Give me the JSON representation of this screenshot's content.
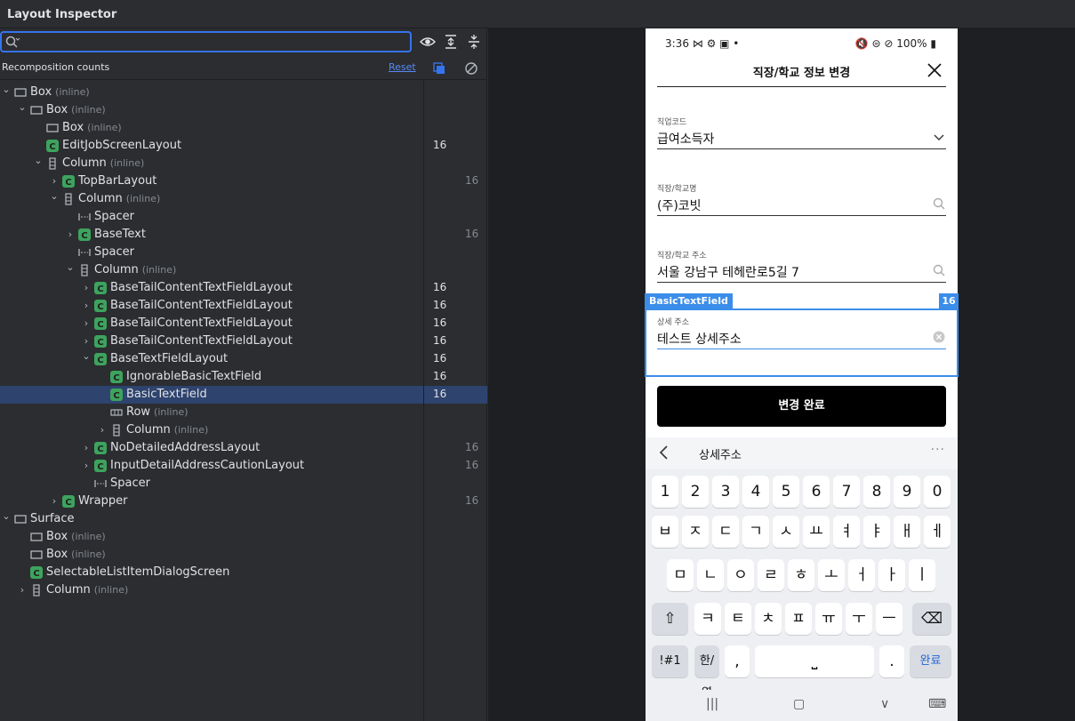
{
  "window": {
    "title": "Layout Inspector"
  },
  "toolbar": {
    "search_value": "",
    "search_placeholder": ""
  },
  "header": {
    "label": "Recomposition counts",
    "reset_label": "Reset"
  },
  "tree": [
    {
      "label": "Box",
      "tag": "(inline)",
      "count": "",
      "icon": "box-icon",
      "chev": "down"
    },
    {
      "label": "Box",
      "tag": "(inline)",
      "count": "",
      "icon": "box-icon",
      "chev": "down"
    },
    {
      "label": "Box",
      "tag": "(inline)",
      "count": "",
      "icon": "box-icon",
      "chev": ""
    },
    {
      "label": "EditJobScreenLayout",
      "tag": "",
      "count": "16",
      "icon": "compose-icon",
      "chev": ""
    },
    {
      "label": "Column",
      "tag": "(inline)",
      "count": "",
      "icon": "column-icon",
      "chev": "down"
    },
    {
      "label": "TopBarLayout",
      "tag": "",
      "count": "16",
      "icon": "compose-icon",
      "chev": "right"
    },
    {
      "label": "Column",
      "tag": "(inline)",
      "count": "",
      "icon": "column-icon",
      "chev": "down"
    },
    {
      "label": "Spacer",
      "tag": "",
      "count": "",
      "icon": "spacer-icon",
      "chev": ""
    },
    {
      "label": "BaseText",
      "tag": "",
      "count": "16",
      "icon": "compose-icon",
      "chev": "right"
    },
    {
      "label": "Spacer",
      "tag": "",
      "count": "",
      "icon": "spacer-icon",
      "chev": ""
    },
    {
      "label": "Column",
      "tag": "(inline)",
      "count": "",
      "icon": "column-icon",
      "chev": "down"
    },
    {
      "label": "BaseTailContentTextFieldLayout",
      "tag": "",
      "count": "16",
      "icon": "compose-icon",
      "chev": "right"
    },
    {
      "label": "BaseTailContentTextFieldLayout",
      "tag": "",
      "count": "16",
      "icon": "compose-icon",
      "chev": "right"
    },
    {
      "label": "BaseTailContentTextFieldLayout",
      "tag": "",
      "count": "16",
      "icon": "compose-icon",
      "chev": "right"
    },
    {
      "label": "BaseTailContentTextFieldLayout",
      "tag": "",
      "count": "16",
      "icon": "compose-icon",
      "chev": "right"
    },
    {
      "label": "BaseTextFieldLayout",
      "tag": "",
      "count": "16",
      "icon": "compose-icon",
      "chev": "down"
    },
    {
      "label": "IgnorableBasicTextField",
      "tag": "",
      "count": "16",
      "icon": "compose-icon",
      "chev": ""
    },
    {
      "label": "BasicTextField",
      "tag": "",
      "count": "16",
      "icon": "compose-icon",
      "chev": ""
    },
    {
      "label": "Row",
      "tag": "(inline)",
      "count": "",
      "icon": "row-icon",
      "chev": ""
    },
    {
      "label": "Column",
      "tag": "(inline)",
      "count": "",
      "icon": "column-icon",
      "chev": "right"
    },
    {
      "label": "NoDetailedAddressLayout",
      "tag": "",
      "count": "16",
      "icon": "compose-icon",
      "chev": "right"
    },
    {
      "label": "InputDetailAddressCautionLayout",
      "tag": "",
      "count": "16",
      "icon": "compose-icon",
      "chev": "right"
    },
    {
      "label": "Spacer",
      "tag": "",
      "count": "",
      "icon": "spacer-icon",
      "chev": ""
    },
    {
      "label": "Wrapper",
      "tag": "",
      "count": "16",
      "icon": "compose-icon",
      "chev": "right"
    },
    {
      "label": "Surface",
      "tag": "",
      "count": "",
      "icon": "box-icon",
      "chev": "down"
    },
    {
      "label": "Box",
      "tag": "(inline)",
      "count": "",
      "icon": "box-icon",
      "chev": ""
    },
    {
      "label": "Box",
      "tag": "(inline)",
      "count": "",
      "icon": "box-icon",
      "chev": ""
    },
    {
      "label": "SelectableListItemDialogScreen",
      "tag": "",
      "count": "",
      "icon": "compose-icon",
      "chev": ""
    },
    {
      "label": "Column",
      "tag": "(inline)",
      "count": "",
      "icon": "column-icon",
      "chev": "right"
    }
  ],
  "device": {
    "status_time": "3:36",
    "status_right": "100%",
    "title": "직장/학교 정보 변경",
    "fields": [
      {
        "label": "직업코드",
        "value": "급여소득자",
        "trail": "chevron-down-icon"
      },
      {
        "label": "직장/학교명",
        "value": "(주)코빗",
        "trail": "search-icon"
      },
      {
        "label": "직장/학교 주소",
        "value": "서울 강남구 테헤란로5길 7",
        "trail": "search-icon"
      },
      {
        "label": "상세 주소",
        "value": "테스트 상세주소",
        "trail": "clear-icon"
      }
    ],
    "highlight_label": "BasicTextField",
    "highlight_count": "16",
    "cta": "변경 완료",
    "keyboard": {
      "suggestion": "상세주소",
      "more": "···",
      "row1": [
        "1",
        "2",
        "3",
        "4",
        "5",
        "6",
        "7",
        "8",
        "9",
        "0"
      ],
      "row2": [
        "ㅂ",
        "ㅈ",
        "ㄷ",
        "ㄱ",
        "ㅅ",
        "ㅛ",
        "ㅕ",
        "ㅑ",
        "ㅐ",
        "ㅔ"
      ],
      "row3": [
        "ㅁ",
        "ㄴ",
        "ㅇ",
        "ㄹ",
        "ㅎ",
        "ㅗ",
        "ㅓ",
        "ㅏ",
        "ㅣ"
      ],
      "row4": [
        "ㅋ",
        "ㅌ",
        "ㅊ",
        "ㅍ",
        "ㅠ",
        "ㅜ",
        "ㅡ"
      ],
      "sym": "!#1",
      "lang": "한/영",
      "comma": ",",
      "space": "⎵",
      "period": ".",
      "done": "완료"
    },
    "nav": {
      "recent": "|||",
      "home": "▢",
      "back": "∨",
      "kb": "⌨"
    }
  },
  "colors": {
    "accent": "#3574f0",
    "selection": "#2e436e",
    "highlight": "#3b8dea",
    "count_active": "#dfe1e5",
    "count_dim": "#868a91"
  }
}
